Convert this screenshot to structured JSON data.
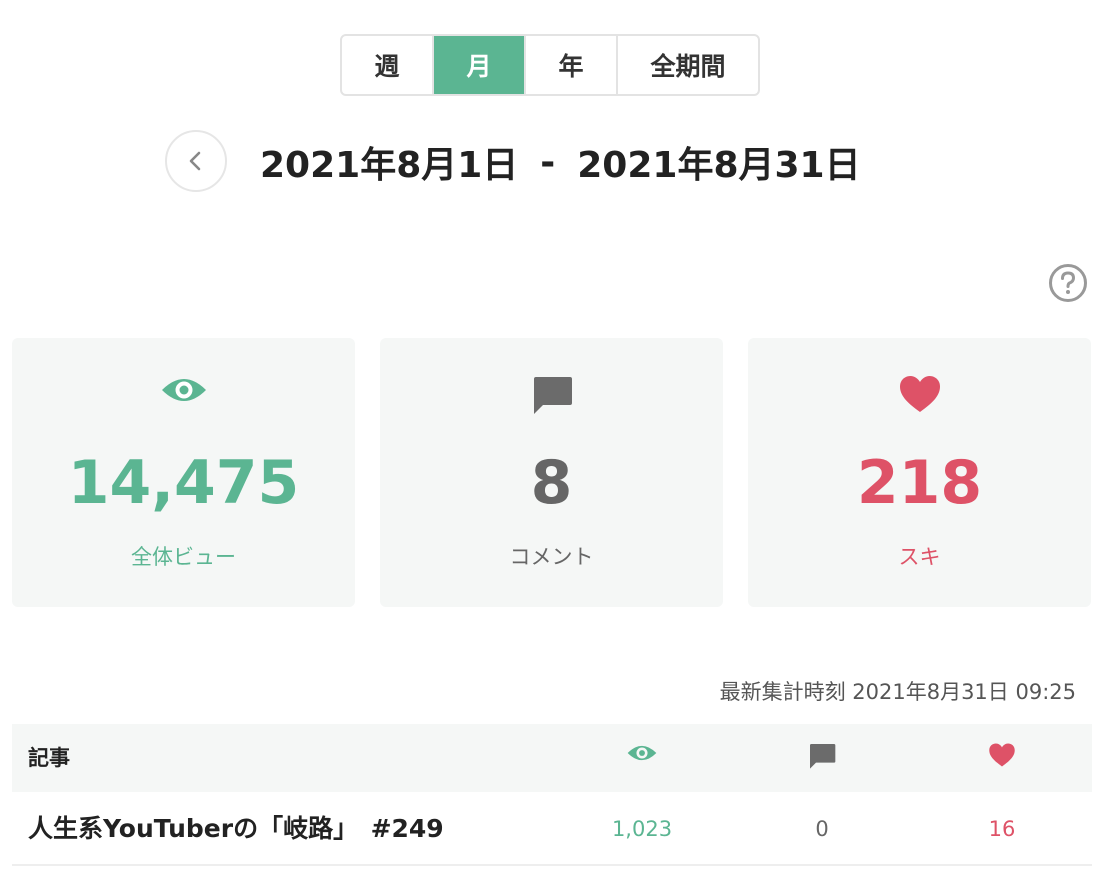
{
  "period_tabs": [
    {
      "label": "週",
      "active": false
    },
    {
      "label": "月",
      "active": true
    },
    {
      "label": "年",
      "active": false
    },
    {
      "label": "全期間",
      "active": false
    }
  ],
  "date_range": {
    "start": "2021年8月1日",
    "separator": "-",
    "end": "2021年8月31日"
  },
  "stats": {
    "views": {
      "value": "14,475",
      "label": "全体ビュー",
      "icon": "eye-icon",
      "color": "#5bb592"
    },
    "comments": {
      "value": "8",
      "label": "コメント",
      "icon": "comment-icon",
      "color": "#666666"
    },
    "likes": {
      "value": "218",
      "label": "スキ",
      "icon": "heart-icon",
      "color": "#de5267"
    }
  },
  "last_updated": "最新集計時刻 2021年8月31日 09:25",
  "table": {
    "header": {
      "article": "記事"
    },
    "rows": [
      {
        "title": "人生系YouTuberの「岐路」　#249",
        "views": "1,023",
        "comments": "0",
        "likes": "16"
      }
    ]
  }
}
